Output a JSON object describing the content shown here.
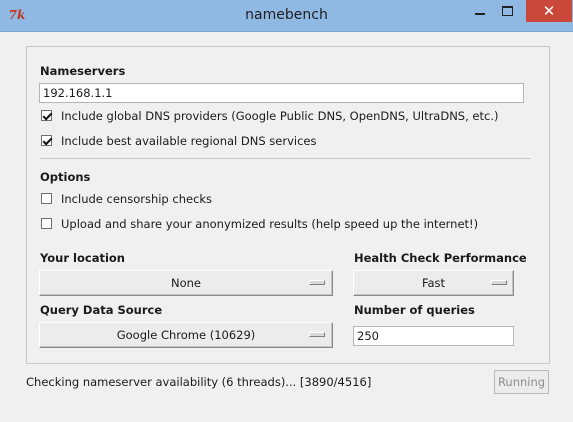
{
  "window": {
    "title": "namebench",
    "app_icon_text": "7k",
    "close_glyph": "✕",
    "icons": [
      "tk-feather-icon",
      "minimize-icon",
      "maximize-icon",
      "close-icon"
    ]
  },
  "nameservers": {
    "heading": "Nameservers",
    "input_value": "192.168.1.1",
    "include_global": {
      "label": "Include global DNS providers (Google Public DNS, OpenDNS, UltraDNS, etc.)",
      "checked": true
    },
    "include_regional": {
      "label": "Include best available regional DNS services",
      "checked": true
    }
  },
  "options": {
    "heading": "Options",
    "censorship": {
      "label": "Include censorship checks",
      "checked": false
    },
    "upload": {
      "label": "Upload and share your anonymized results (help speed up the internet!)",
      "checked": false
    }
  },
  "location": {
    "heading": "Your location",
    "value": "None"
  },
  "health": {
    "heading": "Health Check Performance",
    "value": "Fast"
  },
  "query_source": {
    "heading": "Query Data Source",
    "value": "Google Chrome (10629)"
  },
  "queries": {
    "heading": "Number of queries",
    "value": "250"
  },
  "status": {
    "text": "Checking nameserver availability (6 threads)... [3890/4516]",
    "button_label": "Running",
    "button_enabled": false
  },
  "colors": {
    "titlebar": "#8fb8e3",
    "close_button": "#c9483a",
    "window_bg": "#f0f0f0"
  }
}
